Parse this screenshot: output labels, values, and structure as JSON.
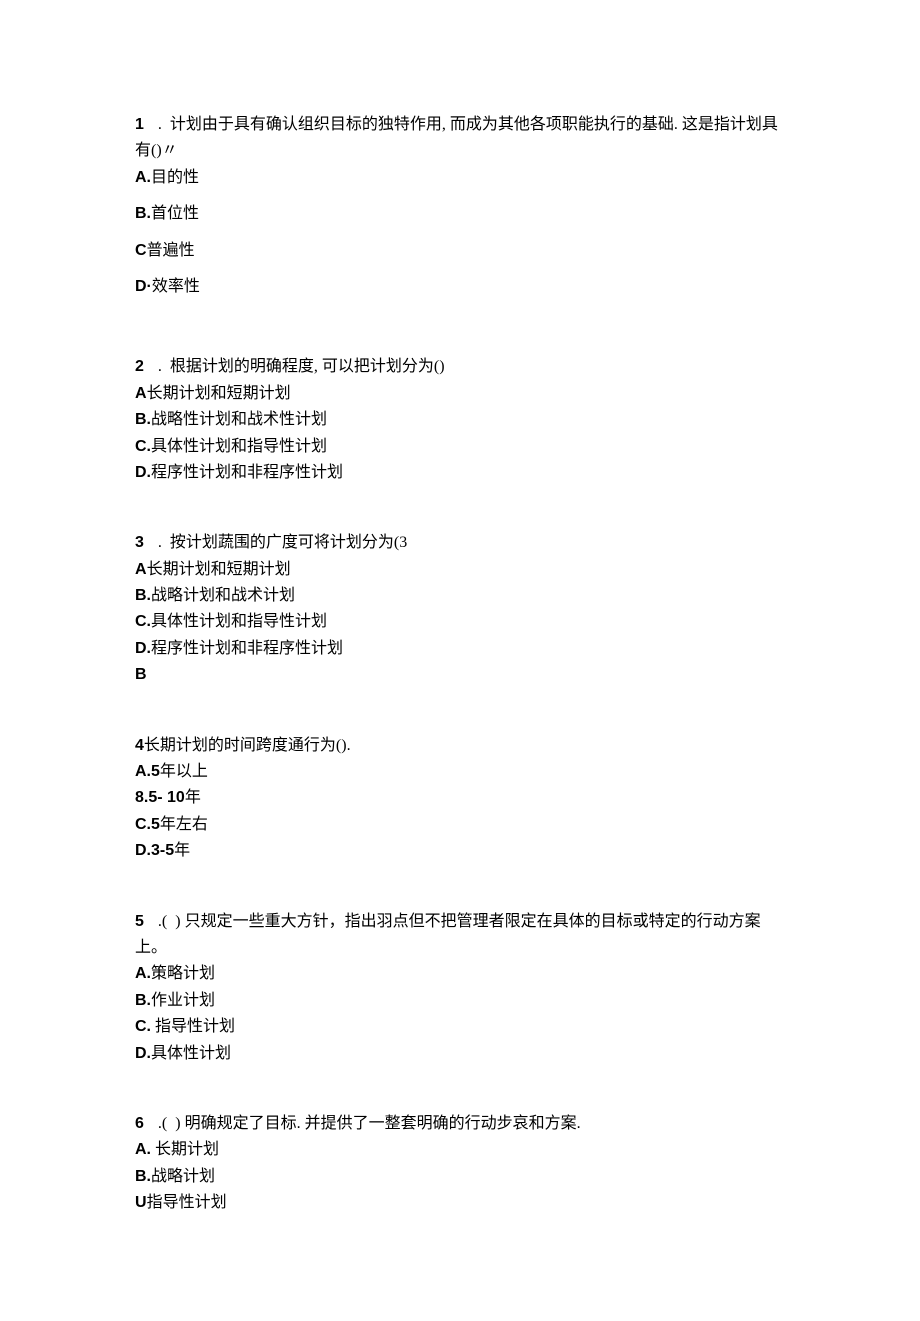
{
  "questions": [
    {
      "num": "1",
      "sep": ".",
      "stem_lines": [
        "计划由于具有确认组织目标的独特作用, 而成为其他各项职能执行的基础. 这是指计划具",
        "有()〃"
      ],
      "options": [
        {
          "label": "A.",
          "text": "目的性",
          "spaced": true
        },
        {
          "label": "B.",
          "text": "首位性",
          "spaced": true
        },
        {
          "label": "C",
          "text": "普遍性",
          "spaced": true
        },
        {
          "label": "D·",
          "text": "效率性",
          "spaced": true
        }
      ],
      "tail": null
    },
    {
      "num": "2",
      "sep": ".",
      "stem_lines": [
        "根据计划的明确程度, 可以把计划分为()"
      ],
      "options": [
        {
          "label": "A",
          "text": "长期计划和短期计划",
          "spaced": false
        },
        {
          "label": "B.",
          "text": "战略性计划和战术性计划",
          "spaced": false
        },
        {
          "label": "C.",
          "text": "具体性计划和指导性计划",
          "spaced": false
        },
        {
          "label": "D.",
          "text": "程序性计划和非程序性计划",
          "spaced": false
        }
      ],
      "tail": null
    },
    {
      "num": "3",
      "sep": ".",
      "stem_lines": [
        "按计划蔬围的广度可将计划分为(3"
      ],
      "options": [
        {
          "label": "A",
          "text": "长期计划和短期计划",
          "spaced": false
        },
        {
          "label": "B.",
          "text": "战略计划和战术计划",
          "spaced": false
        },
        {
          "label": "C.",
          "text": "具体性计划和指导性计划",
          "spaced": false
        },
        {
          "label": "D.",
          "text": "程序性计划和非程序性计划",
          "spaced": false
        }
      ],
      "tail": "B"
    },
    {
      "num": "4",
      "sep": "",
      "stem_lines": [
        "长期计划的时间跨度通行为()."
      ],
      "options": [
        {
          "label": "A.5",
          "text": "年以上",
          "spaced": false
        },
        {
          "label": "8.5-   10",
          "text": "年",
          "spaced": false
        },
        {
          "label": "C.5",
          "text": "年左右",
          "spaced": false
        },
        {
          "label": "D.3-5",
          "text": "年",
          "spaced": false
        }
      ],
      "tail": null
    },
    {
      "num": "5",
      "sep": ".(",
      "stem_lines": [
        ") 只规定一些重大方针，指出羽点但不把管理者限定在具体的目标或特定的行动方案",
        "上。"
      ],
      "options": [
        {
          "label": "A.",
          "text": "策略计划",
          "spaced": false
        },
        {
          "label": "B.",
          "text": "作业计划",
          "spaced": false
        },
        {
          "label": "C.",
          "text": " 指导性计划",
          "spaced": false
        },
        {
          "label": "D.",
          "text": "具体性计划",
          "spaced": false
        }
      ],
      "tail": null
    },
    {
      "num": "6",
      "sep": ".(",
      "stem_lines": [
        ") 明确规定了目标. 并提供了一整套明确的行动步哀和方案."
      ],
      "options": [
        {
          "label": "A.",
          "text": " 长期计划",
          "spaced": false
        },
        {
          "label": "B.",
          "text": "战略计划",
          "spaced": false
        },
        {
          "label": "U",
          "text": "指导性计划",
          "spaced": false
        }
      ],
      "tail": null
    }
  ]
}
